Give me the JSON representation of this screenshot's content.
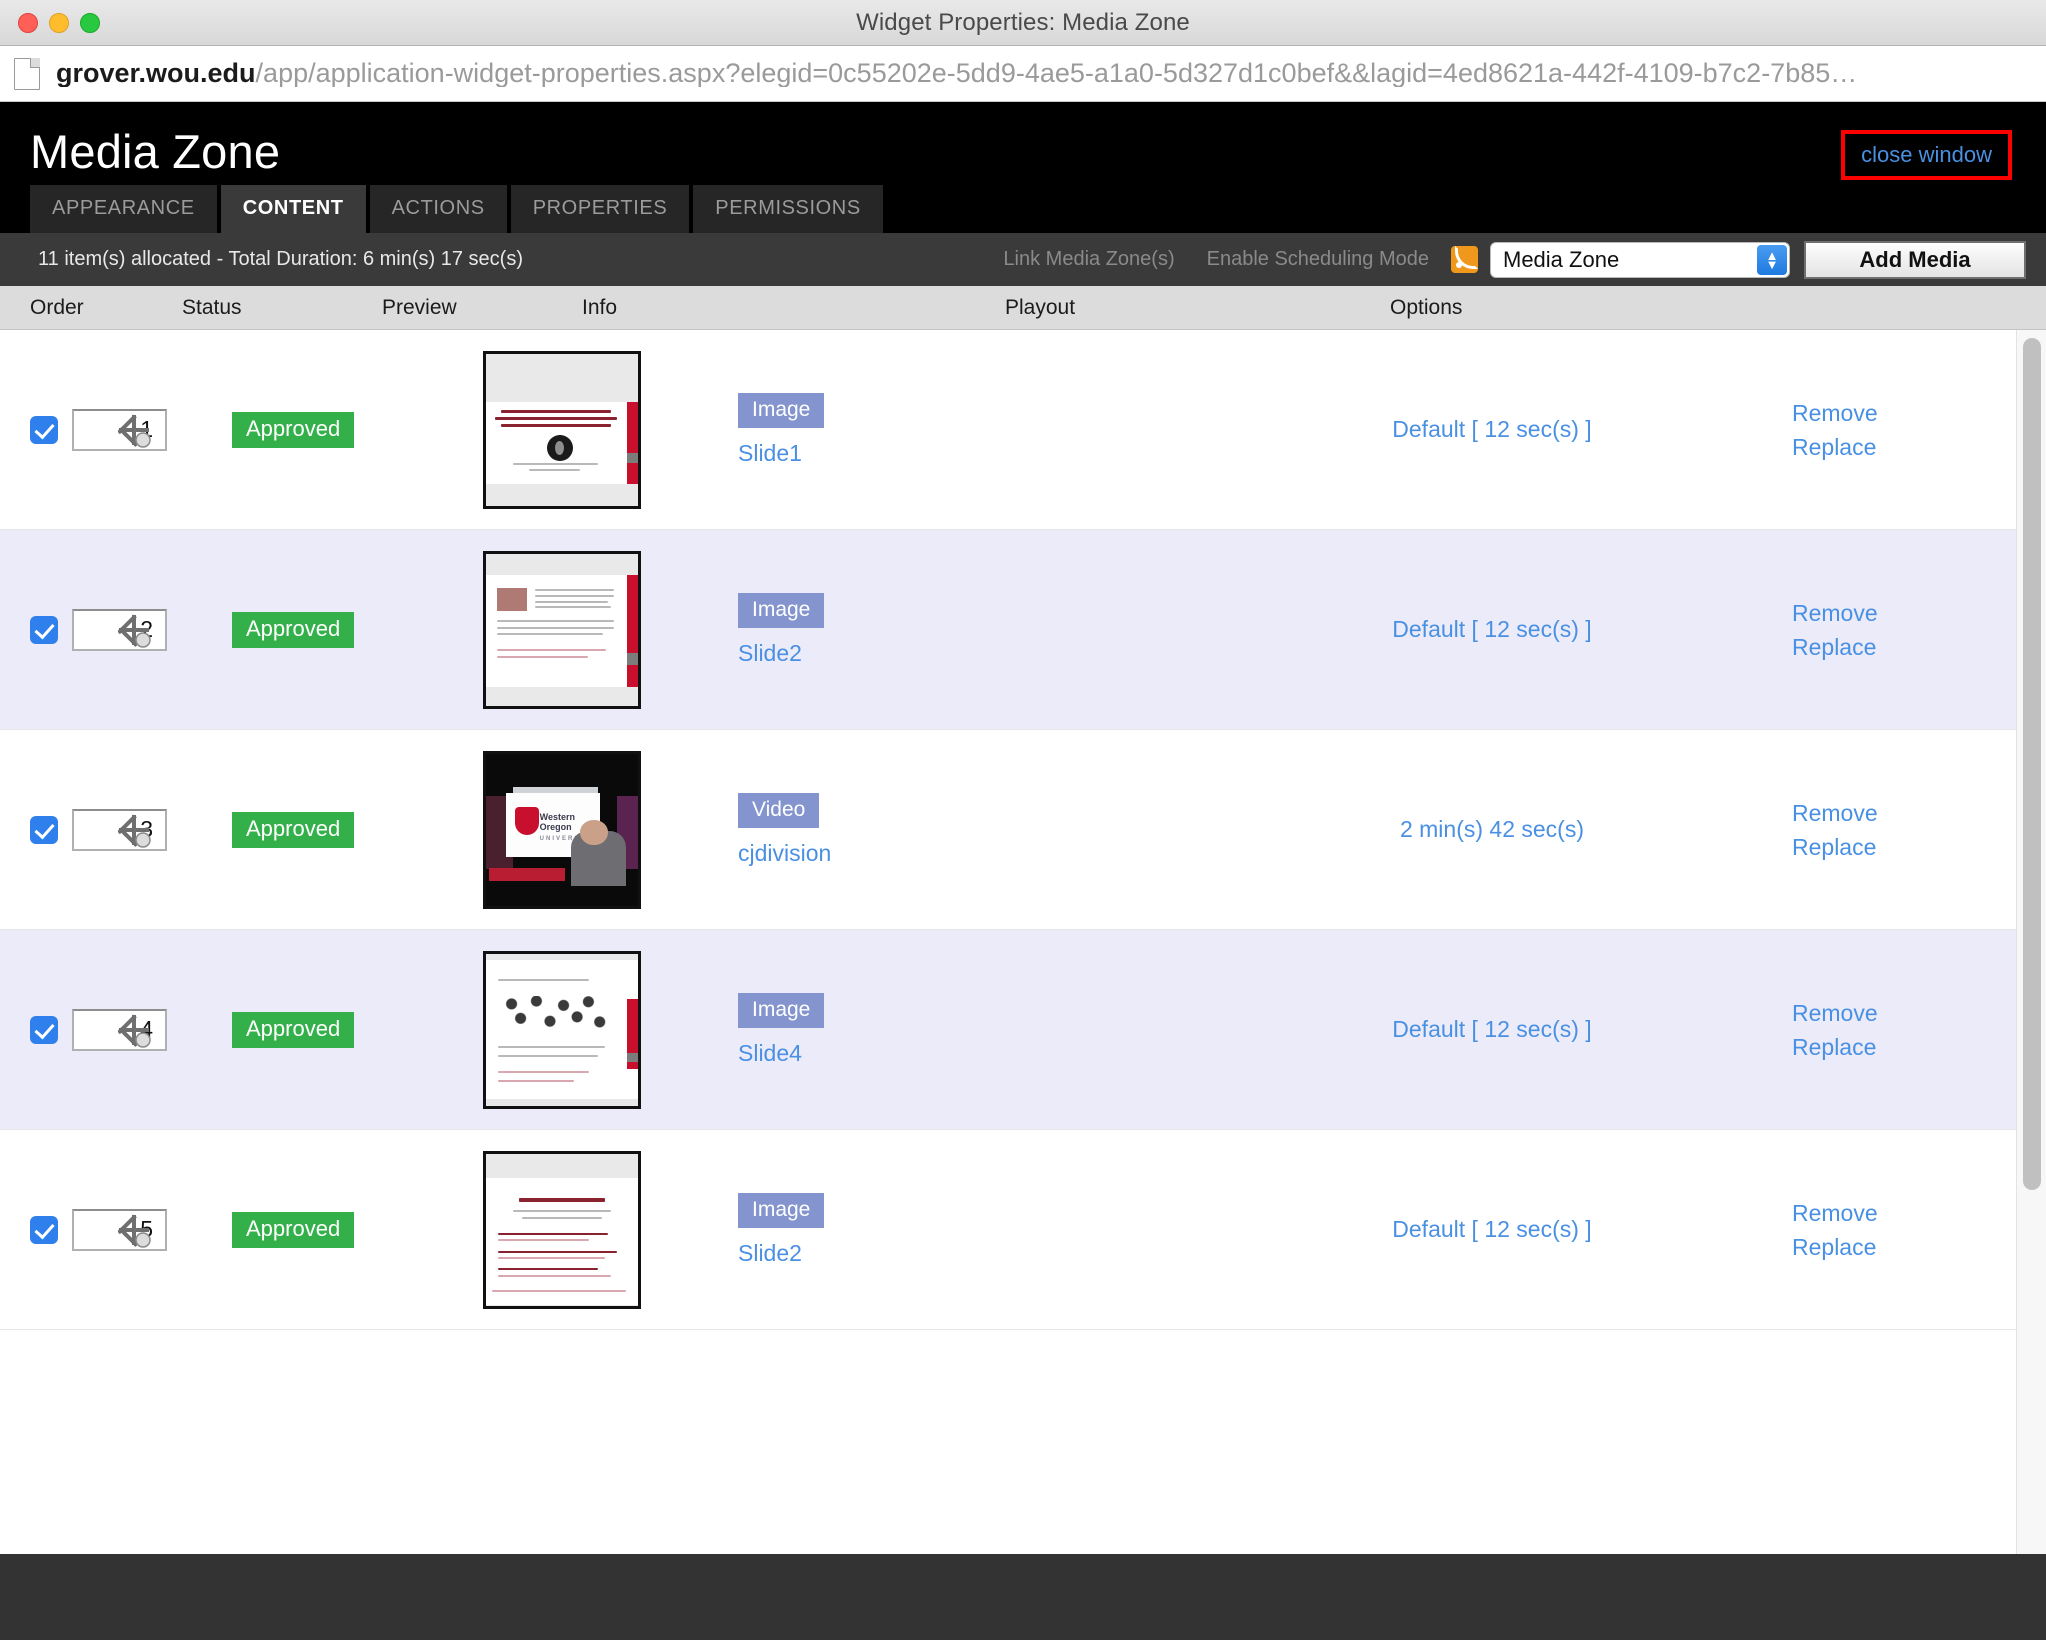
{
  "window": {
    "title": "Widget Properties: Media Zone",
    "traffic_lights": [
      "close",
      "minimize",
      "maximize"
    ]
  },
  "url": {
    "host": "grover.wou.edu",
    "path": "/app/application-widget-properties.aspx?elegid=0c55202e-5dd9-4ae5-a1a0-5d327d1c0bef&&lagid=4ed8621a-442f-4109-b7c2-7b85…"
  },
  "header": {
    "title": "Media Zone",
    "close_window": "close window"
  },
  "tabs": [
    {
      "label": "APPEARANCE",
      "active": false
    },
    {
      "label": "CONTENT",
      "active": true
    },
    {
      "label": "ACTIONS",
      "active": false
    },
    {
      "label": "PROPERTIES",
      "active": false
    },
    {
      "label": "PERMISSIONS",
      "active": false
    }
  ],
  "toolbar": {
    "allocation": "11 item(s) allocated - Total Duration: 6 min(s) 17 sec(s)",
    "link_media_zones": "Link Media Zone(s)",
    "enable_scheduling_mode": "Enable Scheduling Mode",
    "rss_icon": "rss-icon",
    "zone_select_value": "Media Zone",
    "add_media": "Add Media"
  },
  "table": {
    "columns": [
      "Order",
      "Status",
      "Preview",
      "Info",
      "Playout",
      "Options"
    ],
    "options_labels": {
      "remove": "Remove",
      "replace": "Replace"
    },
    "rows": [
      {
        "checked": true,
        "order": "1",
        "status": "Approved",
        "type": "Image",
        "name": "Slide1",
        "playout": "Default [ 12 sec(s) ]",
        "preview": "slide-cj-recognition",
        "alt": false
      },
      {
        "checked": true,
        "order": "2",
        "status": "Approved",
        "type": "Image",
        "name": "Slide2",
        "playout": "Default [ 12 sec(s) ]",
        "preview": "slide-text-portrait",
        "alt": true
      },
      {
        "checked": true,
        "order": "3",
        "status": "Approved",
        "type": "Video",
        "name": "cjdivision",
        "playout": "2 min(s) 42 sec(s)",
        "preview": "video-wou-interview",
        "alt": false
      },
      {
        "checked": true,
        "order": "4",
        "status": "Approved",
        "type": "Image",
        "name": "Slide4",
        "playout": "Default [ 12 sec(s) ]",
        "preview": "slide-faces-grid",
        "alt": true
      },
      {
        "checked": true,
        "order": "5",
        "status": "Approved",
        "type": "Image",
        "name": "Slide2",
        "playout": "Default [ 12 sec(s) ]",
        "preview": "slide-perspectives-on-peace",
        "alt": false
      }
    ]
  },
  "colors": {
    "accent_link": "#4a90e2",
    "approved_green": "#33b04a",
    "type_badge": "#8494cf",
    "highlight_border": "#ff0000",
    "header_bg": "#000000",
    "toolbar_bg": "#3a3a3a",
    "alt_row": "#ebebfa"
  }
}
